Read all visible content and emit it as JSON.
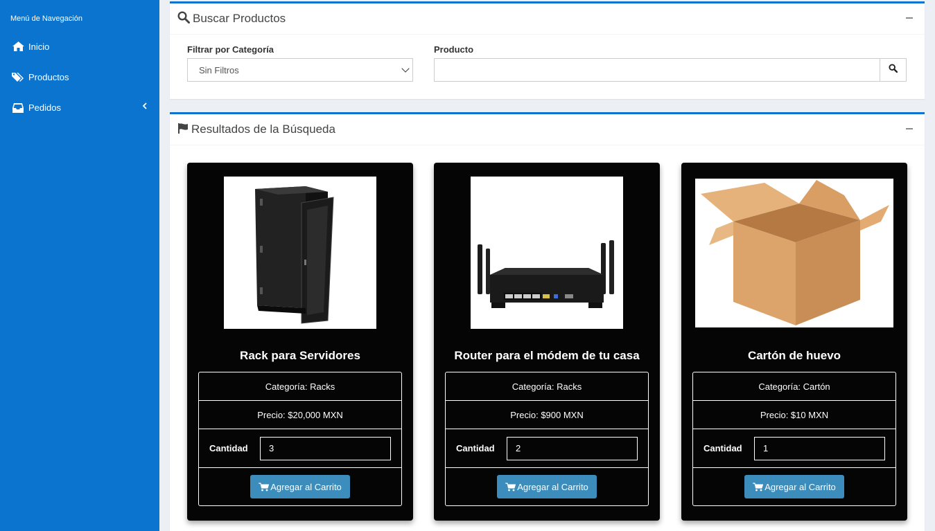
{
  "sidebar": {
    "header": "Menú de Navegación",
    "items": [
      {
        "label": "Inicio",
        "icon": "home-icon"
      },
      {
        "label": "Productos",
        "icon": "tags-icon"
      },
      {
        "label": "Pedidos",
        "icon": "inbox-icon",
        "has_submenu": true
      }
    ]
  },
  "search": {
    "title": "Buscar Productos",
    "category_label": "Filtrar por Categoría",
    "category_selected": "Sin Filtros",
    "product_label": "Producto",
    "product_value": ""
  },
  "results": {
    "title": "Resultados de la Búsqueda",
    "products": [
      {
        "name": "Rack para Servidores",
        "category": "Categoría: Racks",
        "price": "Precio: $20,000 MXN",
        "qty_label": "Cantidad",
        "quantity": "3",
        "button": "Agregar al Carrito"
      },
      {
        "name": "Router para el módem de tu casa",
        "category": "Categoría: Racks",
        "price": "Precio: $900 MXN",
        "qty_label": "Cantidad",
        "quantity": "2",
        "button": "Agregar al Carrito"
      },
      {
        "name": "Cartón de huevo",
        "category": "Categoría: Cartón",
        "price": "Precio: $10 MXN",
        "qty_label": "Cantidad",
        "quantity": "1",
        "button": "Agregar al Carrito"
      }
    ]
  },
  "colors": {
    "sidebar_bg": "#0a74cf",
    "accent": "#3c8dbc",
    "card_bg": "#050505",
    "page_bg": "#ecf0f5"
  }
}
